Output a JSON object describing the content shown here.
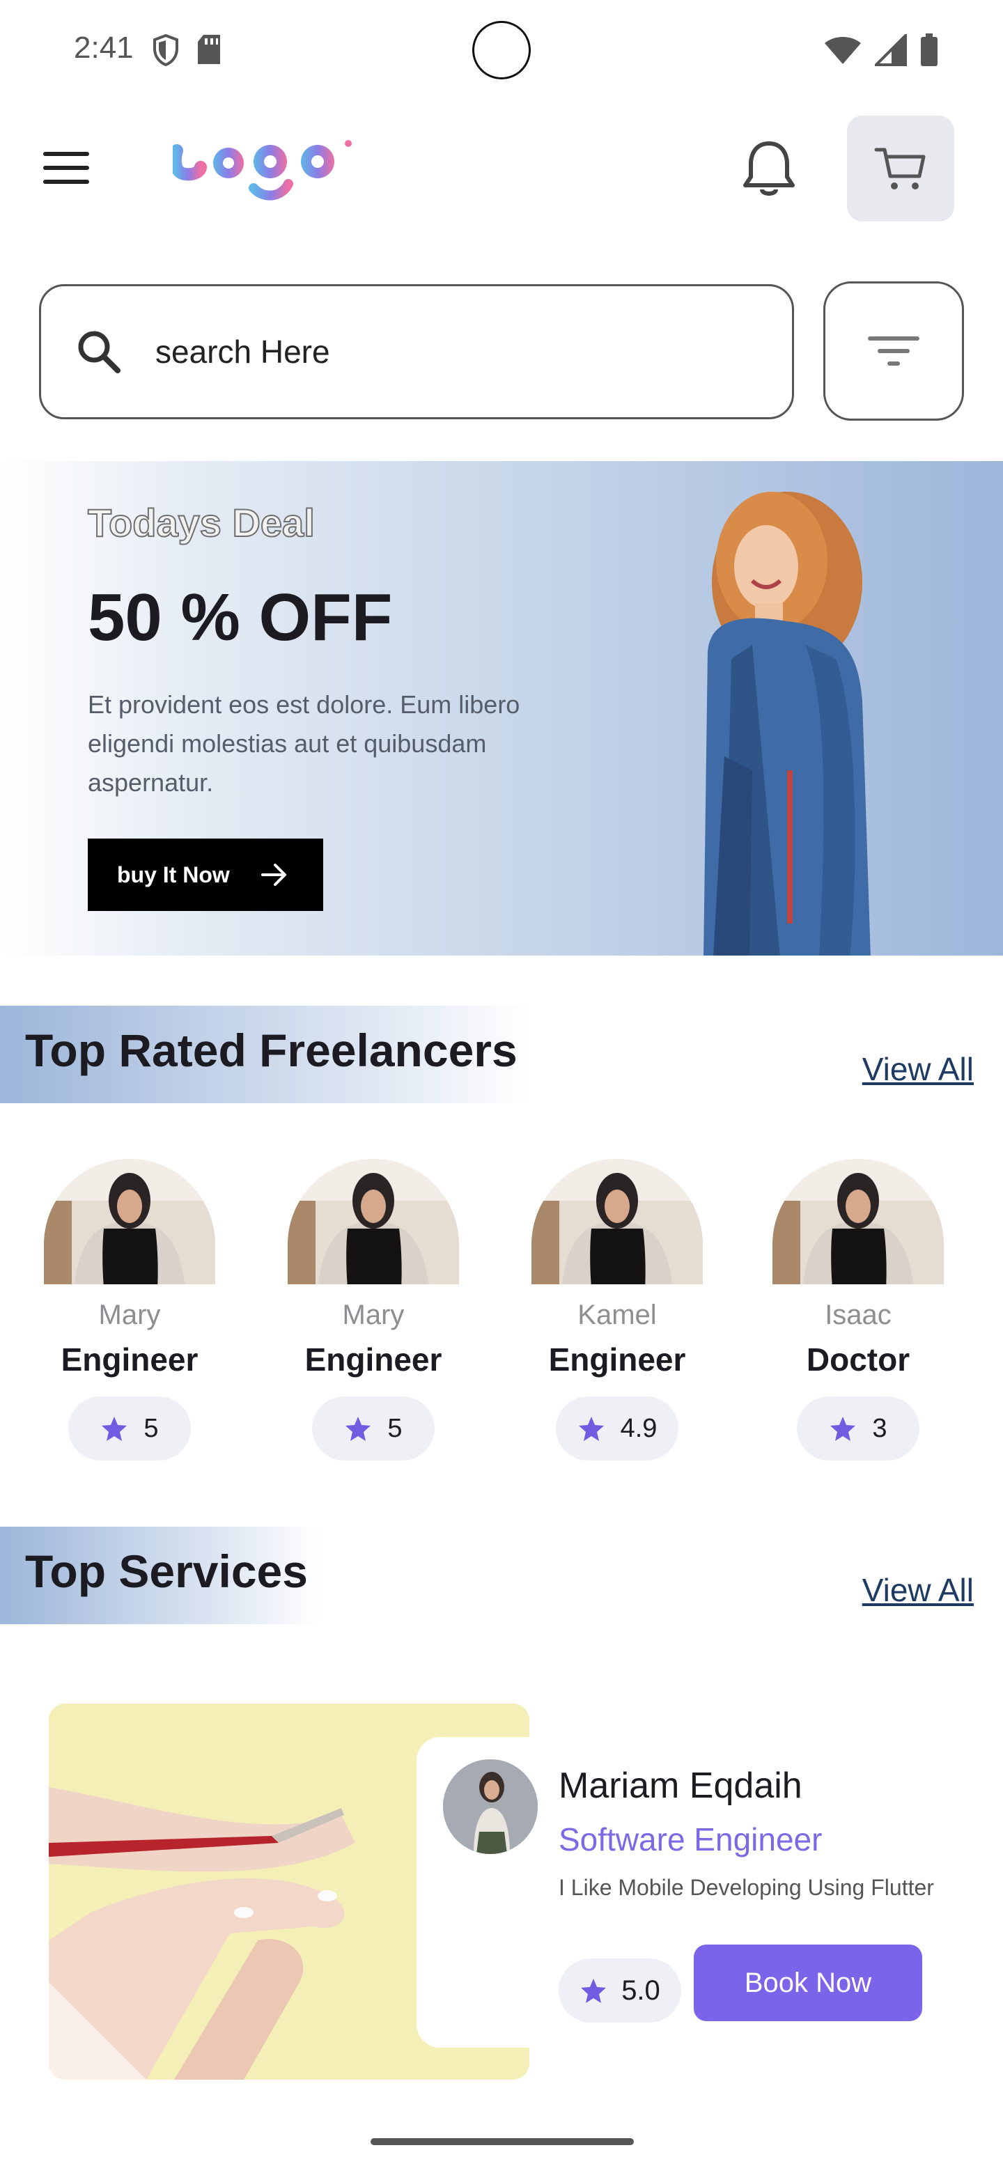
{
  "status_bar": {
    "time": "2:41"
  },
  "header": {
    "logo_text": "Logo"
  },
  "search": {
    "placeholder": "search Here",
    "value": ""
  },
  "deal": {
    "tag": "Todays Deal",
    "title": "50 % OFF",
    "description": "Et provident eos est dolore. Eum libero eligendi molestias aut et quibusdam aspernatur.",
    "button_label": "buy It Now"
  },
  "top_freelancers": {
    "title": "Top Rated Freelancers",
    "view_all": "View All",
    "items": [
      {
        "name": "Mary",
        "role": "Engineer",
        "rating": "5"
      },
      {
        "name": "Mary",
        "role": "Engineer",
        "rating": "5"
      },
      {
        "name": "Kamel",
        "role": "Engineer",
        "rating": "4.9"
      },
      {
        "name": "Isaac",
        "role": "Doctor",
        "rating": "3"
      }
    ]
  },
  "top_services": {
    "title": "Top Services",
    "view_all": "View All",
    "card": {
      "provider_name": "Mariam Eqdaih",
      "provider_role": "Software Engineer",
      "bio": "I Like Mobile Developing Using Flutter",
      "rating": "5.0",
      "book_label": "Book Now"
    }
  },
  "colors": {
    "accent": "#7b63ea",
    "link": "#1e3a63",
    "star": "#6f5ce0"
  }
}
